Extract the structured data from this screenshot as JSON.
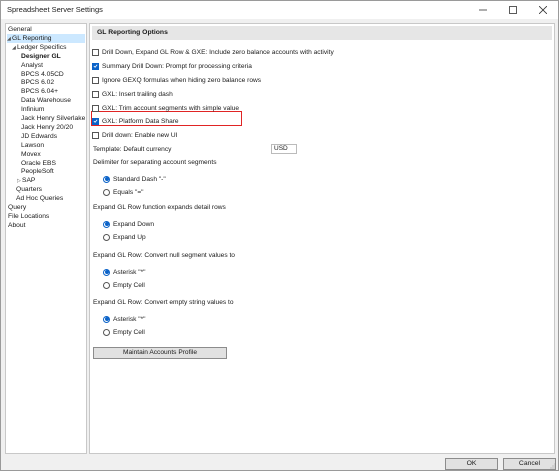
{
  "window": {
    "title": "Spreadsheet Server Settings",
    "minimize": "–",
    "maximize": "☐",
    "close": "✕"
  },
  "tree": [
    {
      "label": "General",
      "indent": 0,
      "expander": "",
      "selected": false,
      "bold": false
    },
    {
      "label": "GL Reporting",
      "indent": 0,
      "expander": "◢",
      "selected": true,
      "bold": false
    },
    {
      "label": "Ledger Specifics",
      "indent": 1,
      "expander": "◢",
      "selected": false,
      "bold": false
    },
    {
      "label": "Designer GL",
      "indent": 2,
      "expander": "",
      "selected": false,
      "bold": true
    },
    {
      "label": "Analyst",
      "indent": 2,
      "expander": "",
      "selected": false,
      "bold": false
    },
    {
      "label": "BPCS 4.05CD",
      "indent": 2,
      "expander": "",
      "selected": false,
      "bold": false
    },
    {
      "label": "BPCS 6.02",
      "indent": 2,
      "expander": "",
      "selected": false,
      "bold": false
    },
    {
      "label": "BPCS 6.04+",
      "indent": 2,
      "expander": "",
      "selected": false,
      "bold": false
    },
    {
      "label": "Data Warehouse",
      "indent": 2,
      "expander": "",
      "selected": false,
      "bold": false
    },
    {
      "label": "Infinium",
      "indent": 2,
      "expander": "",
      "selected": false,
      "bold": false
    },
    {
      "label": "Jack Henry Silverlake",
      "indent": 2,
      "expander": "",
      "selected": false,
      "bold": false
    },
    {
      "label": "Jack Henry 20/20",
      "indent": 2,
      "expander": "",
      "selected": false,
      "bold": false
    },
    {
      "label": "JD Edwards",
      "indent": 2,
      "expander": "",
      "selected": false,
      "bold": false
    },
    {
      "label": "Lawson",
      "indent": 2,
      "expander": "",
      "selected": false,
      "bold": false
    },
    {
      "label": "Movex",
      "indent": 2,
      "expander": "",
      "selected": false,
      "bold": false
    },
    {
      "label": "Oracle EBS",
      "indent": 2,
      "expander": "",
      "selected": false,
      "bold": false
    },
    {
      "label": "PeopleSoft",
      "indent": 2,
      "expander": "",
      "selected": false,
      "bold": false
    },
    {
      "label": "SAP",
      "indent": 2,
      "expander": "▷",
      "selected": false,
      "bold": false
    },
    {
      "label": "Quarters",
      "indent": 1,
      "expander": "",
      "selected": false,
      "bold": false
    },
    {
      "label": "Ad Hoc Queries",
      "indent": 1,
      "expander": "",
      "selected": false,
      "bold": false
    },
    {
      "label": "Query",
      "indent": 0,
      "expander": "",
      "selected": false,
      "bold": false
    },
    {
      "label": "File Locations",
      "indent": 0,
      "expander": "",
      "selected": false,
      "bold": false
    },
    {
      "label": "About",
      "indent": 0,
      "expander": "",
      "selected": false,
      "bold": false
    }
  ],
  "content": {
    "header": "GL Reporting Options",
    "checkboxes": [
      {
        "label": "Drill Down, Expand GL Row & GXE: Include zero balance accounts with activity",
        "checked": false
      },
      {
        "label": "Summary Drill Down: Prompt for processing criteria",
        "checked": true
      },
      {
        "label": "Ignore GEXQ formulas when hiding zero balance rows",
        "checked": false
      },
      {
        "label": "GXL: Insert trailing dash",
        "checked": false
      },
      {
        "label": "GXL: Trim account segments with simple value",
        "checked": false
      },
      {
        "label": "GXL: Platform Data Share",
        "checked": true
      },
      {
        "label": "Drill down: Enable new UI",
        "checked": false
      }
    ],
    "template_currency_label": "Template: Default currency",
    "template_currency_value": "USD",
    "groups": [
      {
        "title": "Delimiter for separating account segments",
        "options": [
          "Standard Dash \"-\"",
          "Equals \"=\""
        ],
        "selected": 0
      },
      {
        "title": "Expand GL Row function expands detail rows",
        "options": [
          "Expand Down",
          "Expand Up"
        ],
        "selected": 0
      },
      {
        "title": "Expand GL Row: Convert null segment values to",
        "options": [
          "Asterisk \"*\"",
          "Empty Cell"
        ],
        "selected": 0
      },
      {
        "title": "Expand GL Row: Convert empty string values to",
        "options": [
          "Asterisk \"*\"",
          "Empty Cell"
        ],
        "selected": 0
      }
    ],
    "maintain_button": "Maintain Accounts Profile"
  },
  "footer": {
    "ok": "OK",
    "cancel": "Cancel"
  }
}
